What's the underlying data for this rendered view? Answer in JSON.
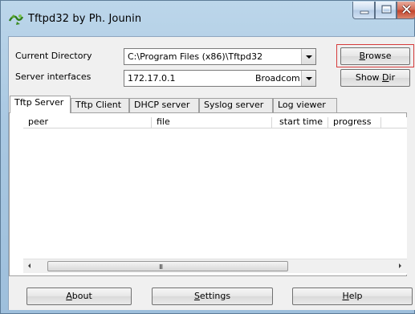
{
  "window": {
    "title": "Tftpd32 by Ph. Jounin"
  },
  "settings": {
    "current_directory_label": "Current Directory",
    "current_directory_value": "C:\\Program Files (x86)\\Tftpd32",
    "server_interfaces_label": "Server interfaces",
    "server_interfaces_ip": "172.17.0.1",
    "server_interfaces_adapter": "Broadcom",
    "browse_button_pre": "",
    "browse_button_u": "B",
    "browse_button_post": "rowse",
    "show_dir_pre": "Show ",
    "show_dir_u": "D",
    "show_dir_post": "ir"
  },
  "tabs": [
    {
      "label": "Tftp Server"
    },
    {
      "label": "Tftp Client"
    },
    {
      "label": "DHCP server"
    },
    {
      "label": "Syslog server"
    },
    {
      "label": "Log viewer"
    }
  ],
  "list": {
    "columns": [
      "peer",
      "file",
      "start time",
      "progress"
    ],
    "rows": [],
    "scroll_grip": "III"
  },
  "footer": {
    "about_u": "A",
    "about_post": "bout",
    "settings_u": "S",
    "settings_post": "ettings",
    "help_u": "H",
    "help_post": "elp"
  },
  "icons": {
    "app": "tftpd-app-icon",
    "minimize": "minimize-icon",
    "maximize": "maximize-icon",
    "close": "close-icon"
  }
}
